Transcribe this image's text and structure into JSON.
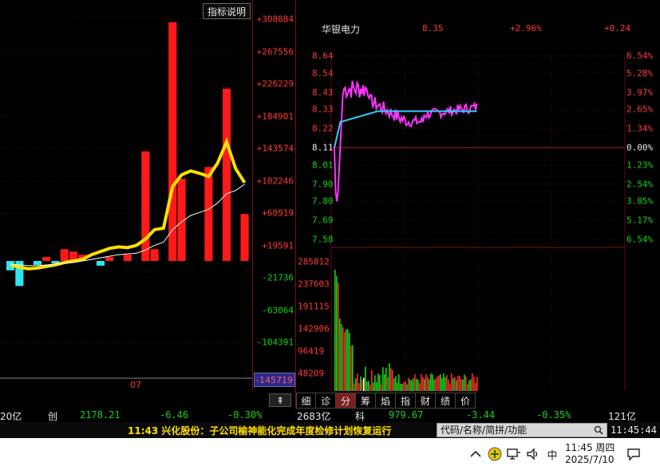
{
  "left_panel": {
    "indicator_button": "指标说明",
    "axis_labels": [
      {
        "text": "+308884",
        "value": 308884,
        "color": "#ff3a3a"
      },
      {
        "text": "+267556",
        "value": 267556,
        "color": "#ff3a3a"
      },
      {
        "text": "+226229",
        "value": 226229,
        "color": "#ff3a3a"
      },
      {
        "text": "+184901",
        "value": 184901,
        "color": "#ff3a3a"
      },
      {
        "text": "+143574",
        "value": 143574,
        "color": "#ff3a3a"
      },
      {
        "text": "+102246",
        "value": 102246,
        "color": "#ff3a3a"
      },
      {
        "text": "+60919",
        "value": 60919,
        "color": "#ff3a3a"
      },
      {
        "text": "+19591",
        "value": 19591,
        "color": "#ff3a3a"
      },
      {
        "text": "-21736",
        "value": -21736,
        "color": "#17d317"
      },
      {
        "text": "-63064",
        "value": -63064,
        "color": "#17d317"
      },
      {
        "text": "-104391",
        "value": -104391,
        "color": "#17d317"
      }
    ],
    "current_value_tag": "-145719",
    "date_label": "07",
    "scroll_button": "⇞"
  },
  "chart_data": {
    "type": "bar",
    "title": "",
    "xlabel": "",
    "ylabel": "",
    "ylim": [
      -150000,
      320000
    ],
    "values": [
      -12000,
      -32000,
      0,
      -5000,
      5000,
      -3000,
      15000,
      12000,
      8000,
      0,
      -6000,
      5000,
      0,
      8000,
      0,
      140000,
      15000,
      0,
      305000,
      105000,
      0,
      0,
      120000,
      0,
      220000,
      0,
      60000
    ],
    "series": [
      {
        "name": "",
        "type": "line",
        "color": "#ffe000",
        "values": [
          -5000,
          -8000,
          -10000,
          -9000,
          -7000,
          -5000,
          -2000,
          0,
          2000,
          8000,
          12000,
          16000,
          18000,
          17000,
          20000,
          28000,
          40000,
          42000,
          95000,
          110000,
          115000,
          112000,
          108000,
          125000,
          152000,
          118000,
          100000
        ]
      },
      {
        "name": "",
        "type": "line",
        "color": "#ffffff",
        "values": [
          -4000,
          -5000,
          -6000,
          -6000,
          -5000,
          -4000,
          -3000,
          -2000,
          0,
          2000,
          4000,
          6000,
          8000,
          9000,
          10000,
          14000,
          20000,
          24000,
          40000,
          50000,
          58000,
          62000,
          66000,
          74000,
          86000,
          90000,
          98000
        ]
      }
    ]
  },
  "right_panel": {
    "stock": {
      "name": "华银电力",
      "price": "8.35",
      "pct": "+2.96%",
      "change": "+0.24"
    },
    "price_labels_left": [
      {
        "text": "8.64",
        "color": "#ff3a3a"
      },
      {
        "text": "8.54",
        "color": "#ff3a3a"
      },
      {
        "text": "8.43",
        "color": "#ff3a3a"
      },
      {
        "text": "8.33",
        "color": "#ff3a3a"
      },
      {
        "text": "8.22",
        "color": "#ff3a3a"
      },
      {
        "text": "8.11",
        "color": "#e8e8e8"
      },
      {
        "text": "8.01",
        "color": "#17d317"
      },
      {
        "text": "7.90",
        "color": "#17d317"
      },
      {
        "text": "7.80",
        "color": "#17d317"
      },
      {
        "text": "7.69",
        "color": "#17d317"
      },
      {
        "text": "7.58",
        "color": "#17d317"
      }
    ],
    "price_labels_right": [
      {
        "text": "6.54%",
        "color": "#ff3a3a"
      },
      {
        "text": "5.28%",
        "color": "#ff3a3a"
      },
      {
        "text": "3.97%",
        "color": "#ff3a3a"
      },
      {
        "text": "2.65%",
        "color": "#ff3a3a"
      },
      {
        "text": "1.34%",
        "color": "#ff3a3a"
      },
      {
        "text": "0.00%",
        "color": "#e8e8e8"
      },
      {
        "text": "1.23%",
        "color": "#17d317"
      },
      {
        "text": "2.54%",
        "color": "#17d317"
      },
      {
        "text": "3.85%",
        "color": "#17d317"
      },
      {
        "text": "5.17%",
        "color": "#17d317"
      },
      {
        "text": "6.54%",
        "color": "#17d317"
      }
    ],
    "volume_labels": [
      "285812",
      "237603",
      "191115",
      "142906",
      "96419",
      "48209"
    ],
    "tabs": [
      "细",
      "诊",
      "分",
      "筹",
      "焰",
      "指",
      "财",
      "绩",
      "价"
    ],
    "active_tab": "分"
  },
  "index_bar": {
    "left_amount": "20亿",
    "board1": "创",
    "board1_value": "2178.21",
    "board1_change": "-6.46",
    "board1_pct": "-0.30%",
    "mid_amount": "2683亿",
    "board2": "科",
    "board2_value": "979.67",
    "board2_change": "-3.44",
    "board2_pct": "-0.35%",
    "right_amount": "121亿"
  },
  "news": {
    "text": "11:43 兴化股份：子公司榆神能化完成年度检修计划恢复运行",
    "search_placeholder": "代码/名称/简拼/功能",
    "clock": "11:45:44"
  },
  "taskbar": {
    "time": "11:45 周四",
    "date": "2025/7/10",
    "ime": "中"
  }
}
